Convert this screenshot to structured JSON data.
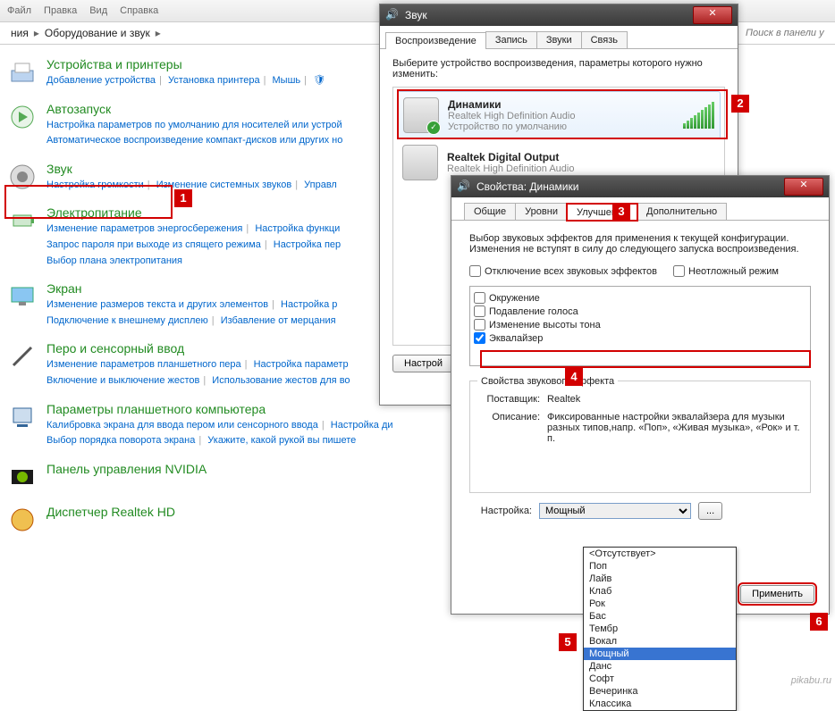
{
  "menu": [
    "...",
    "...",
    "...",
    "...",
    "...",
    "...",
    "..."
  ],
  "breadcrumb": {
    "part1": "ния",
    "part2": "Оборудование и звук",
    "search_ph": "Поиск в панели у"
  },
  "cp": [
    {
      "title": "Устройства и принтеры",
      "links": [
        "Добавление устройства",
        "Установка принтера",
        "Мышь",
        "🛡"
      ]
    },
    {
      "title": "Автозапуск",
      "links": [
        "Настройка параметров по умолчанию для носителей или устрой",
        "Автоматическое воспроизведение компакт-дисков или других но"
      ]
    },
    {
      "title": "Звук",
      "links": [
        "Настройка громкости",
        "Изменение системных звуков",
        "Управл"
      ]
    },
    {
      "title": "Электропитание",
      "links": [
        "Изменение параметров энергосбережения",
        "Настройка функци",
        "Запрос пароля при выходе из спящего режима",
        "Настройка пер",
        "Выбор плана электропитания"
      ]
    },
    {
      "title": "Экран",
      "links": [
        "Изменение размеров текста и других элементов",
        "Настройка р",
        "Подключение к внешнему дисплею",
        "Избавление от мерцания"
      ]
    },
    {
      "title": "Перо и сенсорный ввод",
      "links": [
        "Изменение параметров планшетного пера",
        "Настройка параметр",
        "Включение и выключение жестов",
        "Использование жестов для во"
      ]
    },
    {
      "title": "Параметры планшетного компьютера",
      "links": [
        "Калибровка экрана для ввода пером или сенсорного ввода",
        "Настройка ди",
        "Выбор порядка поворота экрана",
        "Укажите, какой рукой вы пишете"
      ]
    },
    {
      "title": "Панель управления NVIDIA",
      "links": []
    },
    {
      "title": "Диспетчер Realtek HD",
      "links": []
    }
  ],
  "sound": {
    "title": "Звук",
    "tabs": [
      "Воспроизведение",
      "Запись",
      "Звуки",
      "Связь"
    ],
    "desc": "Выберите устройство воспроизведения, параметры которого нужно изменить:",
    "dev1": {
      "name": "Динамики",
      "sub1": "Realtek High Definition Audio",
      "sub2": "Устройство по умолчанию"
    },
    "dev2": {
      "name": "Realtek Digital Output",
      "sub1": "Realtek High Definition Audio"
    },
    "configure": "Настрой"
  },
  "props": {
    "title": "Свойства: Динамики",
    "tabs": [
      "Общие",
      "Уровни",
      "Улучшения",
      "Дополнительно"
    ],
    "intro": "Выбор звуковых эффектов для применения к текущей конфигурации. Изменения не вступят в силу до следующего запуска воспроизведения.",
    "disable_all": "Отключение всех звуковых эффектов",
    "urgent": "Неотложный режим",
    "effects": [
      "Окружение",
      "Подавление голоса",
      "Изменение высоты тона",
      "Эквалайзер"
    ],
    "group": "Свойства звукового эффекта",
    "provider_l": "Поставщик:",
    "provider_v": "Realtek",
    "desc_l": "Описание:",
    "desc_v": "Фиксированные настройки эквалайзера для музыки разных типов,напр. «Поп», «Живая музыка», «Рок» и т. п.",
    "setting_l": "Настройка:",
    "setting_v": "Мощный",
    "more": "...",
    "apply": "Применить",
    "dropdown": [
      "<Отсутствует>",
      "Поп",
      "Лайв",
      "Клаб",
      "Рок",
      "Бас",
      "Тембр",
      "Вокал",
      "Мощный",
      "Данс",
      "Софт",
      "Вечеринка",
      "Классика"
    ]
  },
  "watermark": "pikabu.ru"
}
